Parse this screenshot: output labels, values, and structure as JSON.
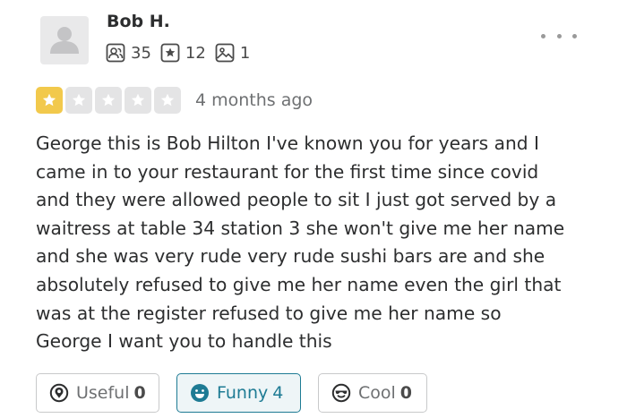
{
  "user": {
    "name": "Bob H.",
    "avatar_icon": "default-avatar-icon"
  },
  "stats": {
    "friends": "35",
    "reviews": "12",
    "photos": "1"
  },
  "menu": {
    "icon": "more-options-icon"
  },
  "rating": {
    "stars": 1,
    "max": 5,
    "filled_color": "#f2c94c",
    "empty_color": "#e4e4e5"
  },
  "review": {
    "date": "4 months ago",
    "text": "George this is Bob Hilton I've known you for years and I\ncame in to your restaurant for the first time since covid\nand they were allowed people to sit I just got served by a\nwaitress at table 34 station 3 she won't give me her name\nand she was very rude very rude sushi bars are and she\nabsolutely refused to give me her name even the girl that\nwas at the register refused to give me her name so\nGeorge I want you to handle this"
  },
  "reactions": {
    "useful": {
      "label": "Useful",
      "count": "0",
      "icon": "lightbulb-icon"
    },
    "funny": {
      "label": "Funny",
      "count": "4",
      "icon": "smiley-face-icon",
      "active": true,
      "accent": "#1e7b94"
    },
    "cool": {
      "label": "Cool",
      "count": "0",
      "icon": "sunglasses-face-icon"
    }
  }
}
